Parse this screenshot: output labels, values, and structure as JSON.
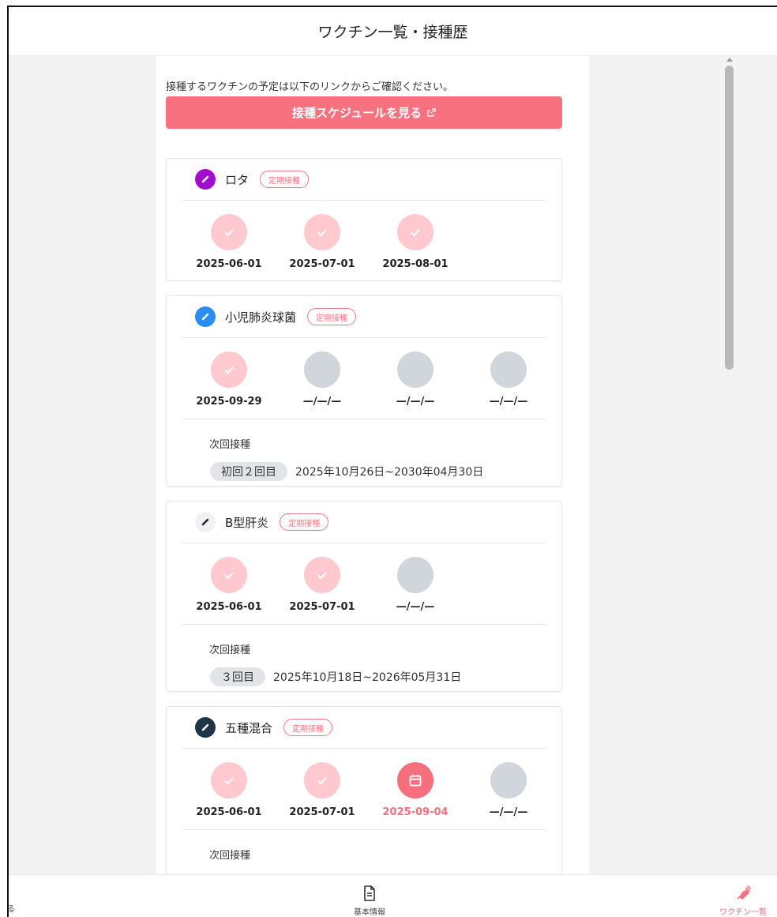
{
  "header": {
    "title": "ワクチン一覧・接種歴"
  },
  "intro": {
    "note": "接種するワクチンの予定は以下のリンクからご確認ください。",
    "schedule_button": "接種スケジュールを見る",
    "external_icon": "external-link-icon"
  },
  "colors": {
    "accent": "#f56f7d",
    "done": "#ffc9cf",
    "pending": "#d1d5dc"
  },
  "vaccines": [
    {
      "name": "ロタ",
      "badge": "定期接種",
      "icon_color": "#a10fc8",
      "doses": [
        {
          "status": "done",
          "date": "2025-06-01"
        },
        {
          "status": "done",
          "date": "2025-07-01"
        },
        {
          "status": "done",
          "date": "2025-08-01"
        }
      ]
    },
    {
      "name": "小児肺炎球菌",
      "badge": "定期接種",
      "icon_color": "#2b8cf2",
      "doses": [
        {
          "status": "done",
          "date": "2025-09-29"
        },
        {
          "status": "pending",
          "date": "—/—/—"
        },
        {
          "status": "pending",
          "date": "—/—/—"
        },
        {
          "status": "pending",
          "date": "—/—/—"
        }
      ],
      "next": {
        "label": "次回接種",
        "round": "初回２回目",
        "range": "2025年10月26日~2030年04月30日"
      }
    },
    {
      "name": "B型肝炎",
      "badge": "定期接種",
      "icon_color": "#f1f1f4",
      "doses": [
        {
          "status": "done",
          "date": "2025-06-01"
        },
        {
          "status": "done",
          "date": "2025-07-01"
        },
        {
          "status": "pending",
          "date": "—/—/—"
        }
      ],
      "next": {
        "label": "次回接種",
        "round": "３回目",
        "range": "2025年10月18日~2026年05月31日"
      }
    },
    {
      "name": "五種混合",
      "badge": "定期接種",
      "icon_color": "#1f3547",
      "doses": [
        {
          "status": "done",
          "date": "2025-06-01"
        },
        {
          "status": "done",
          "date": "2025-07-01"
        },
        {
          "status": "scheduled",
          "date": "2025-09-04"
        },
        {
          "status": "pending",
          "date": "—/—/—"
        }
      ],
      "next": {
        "label": "次回接種"
      }
    }
  ],
  "nav": {
    "left_fragment": "る",
    "basic_info": "基本情報",
    "vaccine_list": "ワクチン一覧"
  }
}
